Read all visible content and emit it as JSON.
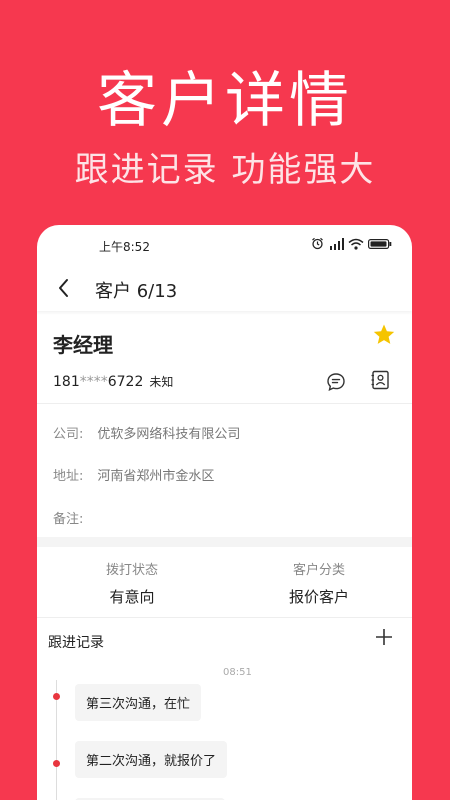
{
  "hero": {
    "title": "客户详情",
    "subtitle": "跟进记录 功能强大"
  },
  "status_bar": {
    "time": "上午8:52",
    "icons": [
      "alarm-icon",
      "cellular-signal-icon",
      "wifi-icon",
      "battery-icon"
    ]
  },
  "nav": {
    "title": "客户 6/13",
    "back_icon": "chevron-left-icon"
  },
  "contact": {
    "name": "李经理",
    "starred": true,
    "phone_prefix": "181",
    "phone_mask": "****",
    "phone_suffix": "6722",
    "gender": "未知",
    "company_label": "公司:",
    "company": "优软多网络科技有限公司",
    "address_label": "地址:",
    "address": "河南省郑州市金水区",
    "note_label": "备注:",
    "note": ""
  },
  "stats": {
    "dial_status_label": "拨打状态",
    "dial_status": "有意向",
    "category_label": "客户分类",
    "category": "报价客户"
  },
  "follow_up": {
    "title": "跟进记录",
    "time": "08:51",
    "records": [
      "第三次沟通，在忙",
      "第二次沟通，就报价了"
    ]
  },
  "colors": {
    "brand_red": "#f6384f",
    "star_yellow": "#f5c400",
    "dot_red": "#e8363f"
  }
}
